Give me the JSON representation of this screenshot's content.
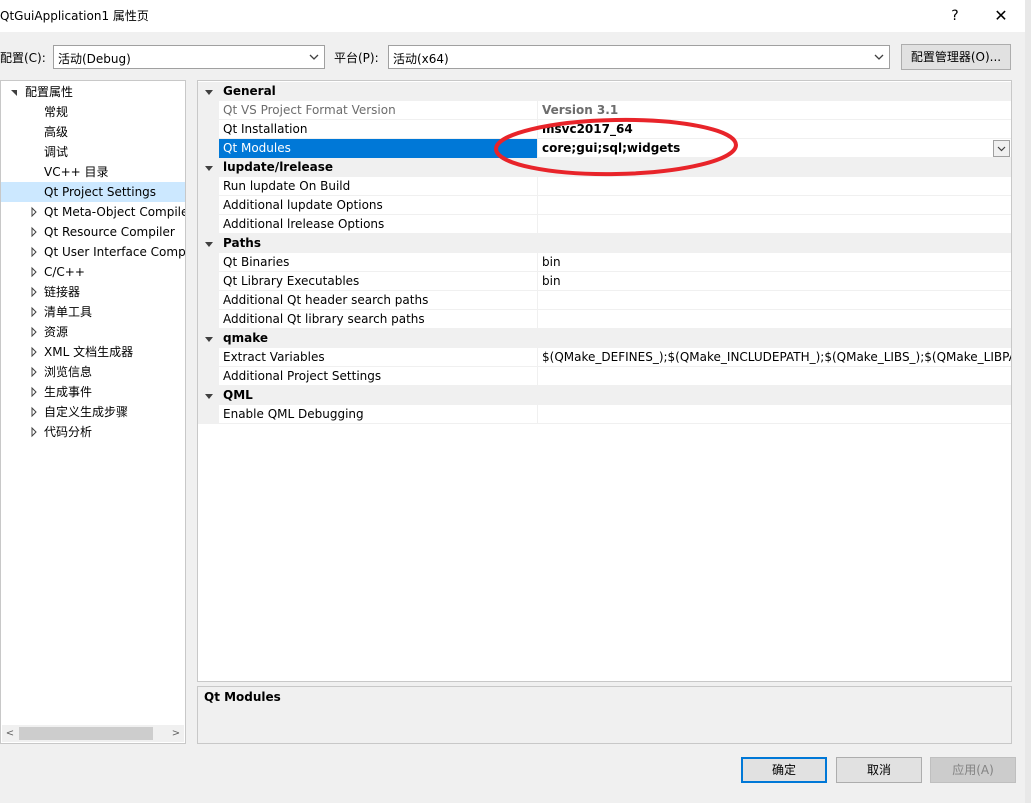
{
  "window": {
    "title": "QtGuiApplication1 属性页",
    "help": "?",
    "close": "✕"
  },
  "config_bar": {
    "config_label": "配置(C):",
    "config_value": "活动(Debug)",
    "platform_label": "平台(P):",
    "platform_value": "活动(x64)",
    "manager_button": "配置管理器(O)..."
  },
  "tree": {
    "items": [
      {
        "label": "配置属性",
        "expander": "down"
      },
      {
        "label": "常规",
        "expander": ""
      },
      {
        "label": "高级",
        "expander": ""
      },
      {
        "label": "调试",
        "expander": ""
      },
      {
        "label": "VC++ 目录",
        "expander": ""
      },
      {
        "label": "Qt Project Settings",
        "expander": "",
        "selected": true
      },
      {
        "label": "Qt Meta-Object Compile",
        "expander": "right"
      },
      {
        "label": "Qt Resource Compiler",
        "expander": "right"
      },
      {
        "label": "Qt User Interface Comp",
        "expander": "right"
      },
      {
        "label": "C/C++",
        "expander": "right"
      },
      {
        "label": "链接器",
        "expander": "right"
      },
      {
        "label": "清单工具",
        "expander": "right"
      },
      {
        "label": "资源",
        "expander": "right"
      },
      {
        "label": "XML 文档生成器",
        "expander": "right"
      },
      {
        "label": "浏览信息",
        "expander": "right"
      },
      {
        "label": "生成事件",
        "expander": "right"
      },
      {
        "label": "自定义生成步骤",
        "expander": "right"
      },
      {
        "label": "代码分析",
        "expander": "right"
      }
    ],
    "scroll_left": "<",
    "scroll_right": ">"
  },
  "grid": {
    "rows": [
      {
        "type": "category",
        "name": "General"
      },
      {
        "type": "prop",
        "name": "Qt VS Project Format Version",
        "value": "Version 3.1",
        "dim": true,
        "bold": true
      },
      {
        "type": "prop",
        "name": "Qt Installation",
        "value": "msvc2017_64",
        "bold": true
      },
      {
        "type": "prop",
        "name": "Qt Modules",
        "value": "core;gui;sql;widgets",
        "bold": true,
        "selected": true,
        "dropdown": true
      },
      {
        "type": "category",
        "name": "lupdate/lrelease"
      },
      {
        "type": "prop",
        "name": "Run lupdate On Build",
        "value": ""
      },
      {
        "type": "prop",
        "name": "Additional lupdate Options",
        "value": ""
      },
      {
        "type": "prop",
        "name": "Additional lrelease Options",
        "value": ""
      },
      {
        "type": "category",
        "name": "Paths"
      },
      {
        "type": "prop",
        "name": "Qt Binaries",
        "value": "bin"
      },
      {
        "type": "prop",
        "name": "Qt Library Executables",
        "value": "bin"
      },
      {
        "type": "prop",
        "name": "Additional Qt header search paths",
        "value": ""
      },
      {
        "type": "prop",
        "name": "Additional Qt library search paths",
        "value": ""
      },
      {
        "type": "category",
        "name": "qmake"
      },
      {
        "type": "prop",
        "name": "Extract Variables",
        "value": "$(QMake_DEFINES_);$(QMake_INCLUDEPATH_);$(QMake_LIBS_);$(QMake_LIBPATH_)"
      },
      {
        "type": "prop",
        "name": "Additional Project Settings",
        "value": ""
      },
      {
        "type": "category",
        "name": "QML"
      },
      {
        "type": "prop",
        "name": "Enable QML Debugging",
        "value": ""
      }
    ]
  },
  "description": {
    "title": "Qt Modules"
  },
  "buttons": {
    "ok": "确定",
    "cancel": "取消",
    "apply": "应用(A)"
  },
  "colors": {
    "selection": "#0078d7",
    "tree_selection": "#cce8ff",
    "annotation": "#e8242a"
  }
}
